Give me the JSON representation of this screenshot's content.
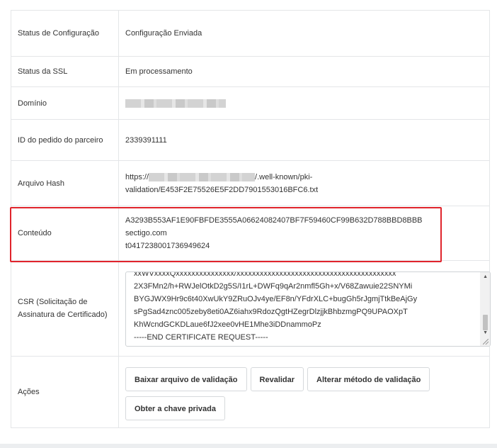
{
  "rows": {
    "config_status": {
      "label": "Status de Configuração",
      "value": "Configuração Enviada"
    },
    "ssl_status": {
      "label": "Status da SSL",
      "value": "Em processamento"
    },
    "domain": {
      "label": "Domínio"
    },
    "partner_order_id": {
      "label": "ID do pedido do parceiro",
      "value": "2339391111"
    },
    "hash_file": {
      "label": "Arquivo Hash",
      "value_prefix": "https://",
      "value_suffix": "/.well-known/pki-",
      "value_line2": "validation/E453F2E75526E5F2DD7901553016BFC6.txt"
    },
    "content": {
      "label": "Conteúdo",
      "line1": "A3293B553AF1E90FBFDE3555A06624082407BF7F59460CF99B632D788BBD8BBB",
      "line2": "sectigo.com",
      "line3": "t0417238001736949624"
    },
    "csr": {
      "label": "CSR (Solicitação de Assinatura de Certificado)",
      "text": "xxWVxxxxQxxxxxxxxxxxxxxx/xxxxxxxxxxxxxxxxxxxxxxxxxxxxxxxxxxxxxxxxx\n2X3FMn2/h+RWJelOtkD2g5S/I1rL+DWFq9qAr2nmfl5Gh+x/V68Zawuie22SNYMi\nBYGJWX9Hr9c6t40XwUkY9ZRuOJv4ye/EF8n/YFdrXLC+bugGh5rJgmjTtkBeAjGy\nsPgSad4znc005zeby8eti0AZ6iahx9RdozQgtHZegrDlzjjkBhbzmgPQ9UPAOXpT\nKhWcndGCKDLaue6fJ2xee0vHE1Mhe3iDDnammoPz\n-----END CERTIFICATE REQUEST-----"
    },
    "actions": {
      "label": "Ações",
      "download_label": "Baixar arquivo de validação",
      "revalidate_label": "Revalidar",
      "change_method_label": "Alterar método de validação",
      "private_key_label": "Obter a chave privada"
    }
  },
  "colors": {
    "highlight": "#e0242c",
    "border": "#e4e6e8"
  }
}
